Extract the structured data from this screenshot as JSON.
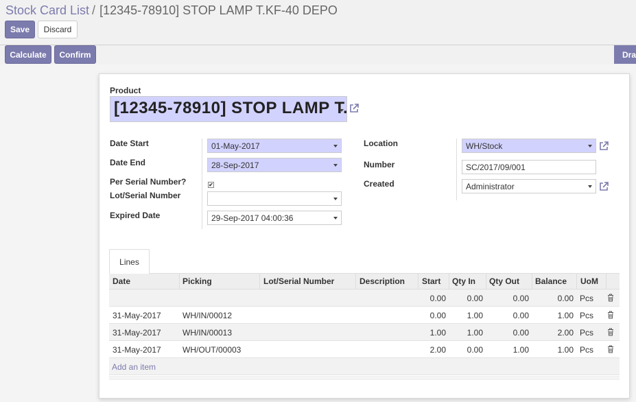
{
  "breadcrumb": {
    "parent": "Stock Card List",
    "separator": "/",
    "current": "[12345-78910] STOP LAMP T.KF-40 DEPO"
  },
  "buttons": {
    "save": "Save",
    "discard": "Discard",
    "calculate": "Calculate",
    "confirm": "Confirm",
    "status_draft": "Draft"
  },
  "form": {
    "product_label": "Product",
    "product_value": "[12345-78910] STOP LAMP T.KF-40 DEPO",
    "date_start_label": "Date Start",
    "date_start_value": "01-May-2017",
    "date_end_label": "Date End",
    "date_end_value": "28-Sep-2017",
    "per_serial_label": "Per Serial Number?",
    "per_serial_checked": true,
    "lot_serial_label": "Lot/Serial Number",
    "lot_serial_value": "",
    "expired_label": "Expired Date",
    "expired_value": "29-Sep-2017 04:00:36",
    "location_label": "Location",
    "location_value": "WH/Stock",
    "number_label": "Number",
    "number_value": "SC/2017/09/001",
    "created_label": "Created",
    "created_value": "Administrator"
  },
  "tabs": [
    {
      "label": "Lines"
    }
  ],
  "lines": {
    "headers": [
      "Date",
      "Picking",
      "Lot/Serial Number",
      "Description",
      "Start",
      "Qty In",
      "Qty Out",
      "Balance",
      "UoM"
    ],
    "rows": [
      {
        "date": "",
        "picking": "",
        "lot": "",
        "description": "",
        "start": "0.00",
        "qty_in": "0.00",
        "qty_out": "0.00",
        "balance": "0.00",
        "uom": "Pcs"
      },
      {
        "date": "31-May-2017",
        "picking": "WH/IN/00012",
        "lot": "",
        "description": "",
        "start": "0.00",
        "qty_in": "1.00",
        "qty_out": "0.00",
        "balance": "1.00",
        "uom": "Pcs"
      },
      {
        "date": "31-May-2017",
        "picking": "WH/IN/00013",
        "lot": "",
        "description": "",
        "start": "1.00",
        "qty_in": "1.00",
        "qty_out": "0.00",
        "balance": "2.00",
        "uom": "Pcs"
      },
      {
        "date": "31-May-2017",
        "picking": "WH/OUT/00003",
        "lot": "",
        "description": "",
        "start": "2.00",
        "qty_in": "0.00",
        "qty_out": "1.00",
        "balance": "1.00",
        "uom": "Pcs"
      }
    ],
    "add_item": "Add an item"
  },
  "icons": {
    "external_link": "external-link-icon",
    "trash": "trash-icon",
    "dropdown": "chevron-down-icon",
    "checkbox": "checkbox-icon"
  },
  "colors": {
    "accent": "#7c7bad",
    "required_field": "#d2d2ff",
    "link": "#7c7bad"
  }
}
